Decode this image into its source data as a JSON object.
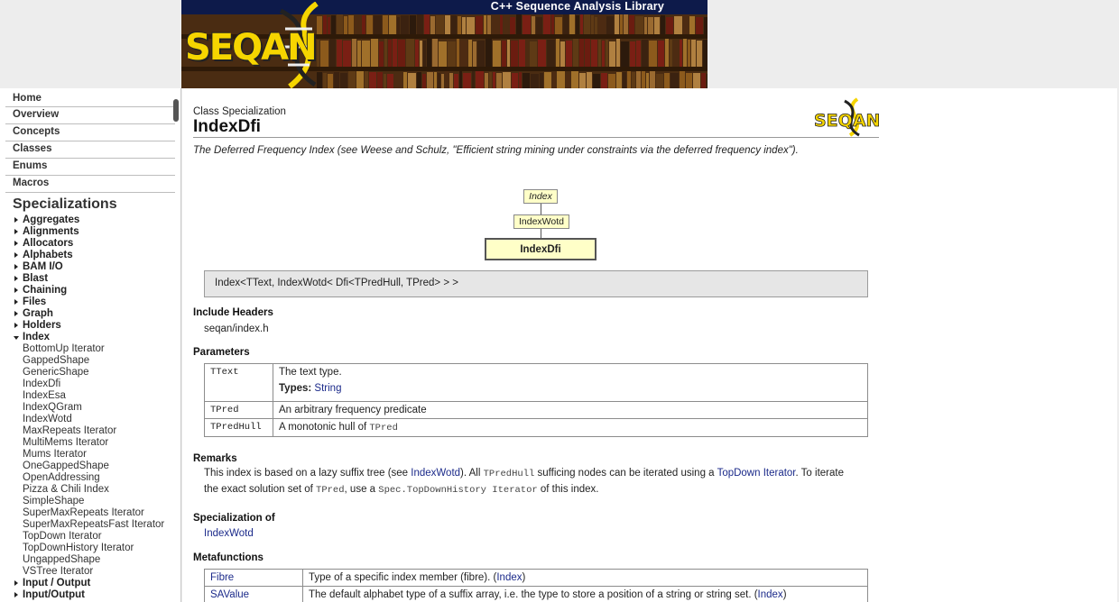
{
  "banner": {
    "tagline": "C++ Sequence Analysis Library",
    "logo": "SEQAN"
  },
  "sidebar": {
    "top_links": [
      "Home",
      "Overview",
      "Concepts",
      "Classes",
      "Enums",
      "Macros"
    ],
    "specializations_heading": "Specializations",
    "categories": [
      "Aggregates",
      "Alignments",
      "Allocators",
      "Alphabets",
      "BAM I/O",
      "Blast",
      "Chaining",
      "Files",
      "Graph",
      "Holders"
    ],
    "open_category": "Index",
    "index_items": [
      "BottomUp Iterator",
      "GappedShape",
      "GenericShape",
      "IndexDfi",
      "IndexEsa",
      "IndexQGram",
      "IndexWotd",
      "MaxRepeats Iterator",
      "MultiMems Iterator",
      "Mums Iterator",
      "OneGappedShape",
      "OpenAddressing",
      "Pizza & Chili Index",
      "SimpleShape",
      "SuperMaxRepeats Iterator",
      "SuperMaxRepeatsFast Iterator",
      "TopDown Iterator",
      "TopDownHistory Iterator",
      "UngappedShape",
      "VSTree Iterator"
    ],
    "after_categories": [
      "Input / Output",
      "Input/Output"
    ]
  },
  "page": {
    "kind": "Class Specialization",
    "title": "IndexDfi",
    "logo_text": "SEQAN",
    "description": "The Deferred Frequency Index (see Weese and Schulz, \"Efficient string mining under constraints via the deferred frequency index\").",
    "diagram": {
      "root": "Index",
      "middle": "IndexWotd",
      "current": "IndexDfi"
    },
    "signature": "Index<TText, IndexWotd< Dfi<TPredHull, TPred> > >",
    "include_heading": "Include Headers",
    "include_file": "seqan/index.h",
    "parameters_heading": "Parameters",
    "parameters": [
      {
        "name": "TText",
        "desc": "The text type.",
        "types_label": "Types:",
        "types_value": "String"
      },
      {
        "name": "TPred",
        "desc": "An arbitrary frequency predicate"
      },
      {
        "name": "TPredHull",
        "desc": "A monotonic hull of",
        "desc_code": "TPred"
      }
    ],
    "remarks_heading": "Remarks",
    "remarks": {
      "t1": "This index is based on a lazy suffix tree (see ",
      "l1": "IndexWotd",
      "t2": "). All ",
      "c1": "TPredHull",
      "t3": " sufficing nodes can be iterated using a ",
      "l2": "TopDown Iterator",
      "t4": ". To iterate the exact solution set of ",
      "c2": "TPred",
      "t5": ", use a ",
      "c3": "Spec.TopDownHistory Iterator",
      "t6": " of this index."
    },
    "specialization_heading": "Specialization of",
    "specialization_of": "IndexWotd",
    "metafunctions_heading": "Metafunctions",
    "metafunctions": [
      {
        "name": "Fibre",
        "desc": "Type of a specific index member (fibre). (",
        "link": "Index",
        "end": ")"
      },
      {
        "name": "SAValue",
        "desc": "The default alphabet type of a suffix array, i.e. the type to store a position of a string or string set. (",
        "link": "Index",
        "end": ")"
      }
    ]
  }
}
